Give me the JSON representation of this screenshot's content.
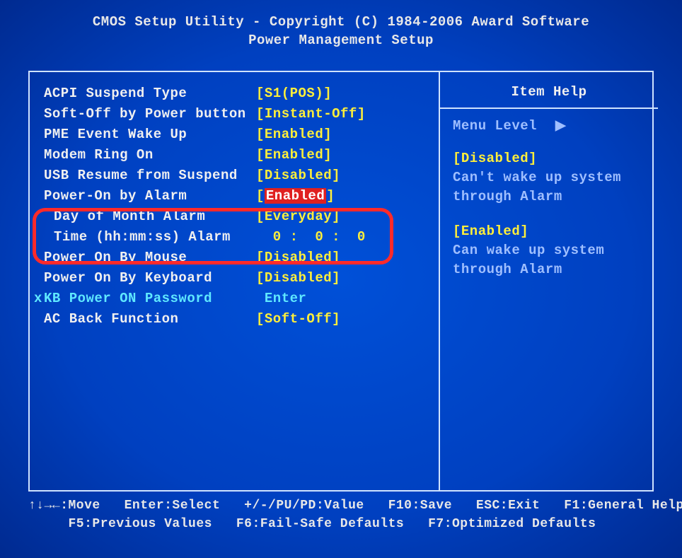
{
  "header": {
    "line1": "CMOS Setup Utility - Copyright (C) 1984-2006 Award Software",
    "line2": "Power Management Setup"
  },
  "settings": [
    {
      "label": "ACPI Suspend Type",
      "value": "[S1(POS)]",
      "indent": false,
      "disabled": false,
      "highlight": false
    },
    {
      "label": "Soft-Off by Power button",
      "value": "[Instant-Off]",
      "indent": false,
      "disabled": false,
      "highlight": false
    },
    {
      "label": "PME Event Wake Up",
      "value": "[Enabled]",
      "indent": false,
      "disabled": false,
      "highlight": false
    },
    {
      "label": "Modem Ring On",
      "value": "[Enabled]",
      "indent": false,
      "disabled": false,
      "highlight": false
    },
    {
      "label": "USB Resume from Suspend",
      "value": "[Disabled]",
      "indent": false,
      "disabled": false,
      "highlight": false
    },
    {
      "label": "Power-On by Alarm",
      "value": "Enabled",
      "indent": false,
      "disabled": false,
      "highlight": true
    },
    {
      "label": "Day of Month Alarm",
      "value": "[Everyday]",
      "indent": true,
      "disabled": false,
      "highlight": false
    },
    {
      "label": "Time (hh:mm:ss) Alarm",
      "value": "  0 :  0 :  0",
      "indent": true,
      "disabled": false,
      "highlight": false
    },
    {
      "label": "Power On By Mouse",
      "value": "[Disabled]",
      "indent": false,
      "disabled": false,
      "highlight": false
    },
    {
      "label": "Power On By Keyboard",
      "value": "[Disabled]",
      "indent": false,
      "disabled": false,
      "highlight": false
    },
    {
      "label": "KB Power ON Password",
      "value": " Enter",
      "indent": false,
      "disabled": true,
      "highlight": false,
      "prefix": "x"
    },
    {
      "label": "AC Back Function",
      "value": "[Soft-Off]",
      "indent": false,
      "disabled": false,
      "highlight": false
    }
  ],
  "help": {
    "title": "Item Help",
    "menu_level_label": "Menu Level",
    "menu_level_arrow": "▶",
    "disabled_head": "[Disabled]",
    "disabled_body1": "Can't wake up system",
    "disabled_body2": "through Alarm",
    "enabled_head": "[Enabled]",
    "enabled_body1": "Can wake up system",
    "enabled_body2": "through Alarm"
  },
  "footer": {
    "line1": "↑↓→←:Move   Enter:Select   +/-/PU/PD:Value   F10:Save   ESC:Exit   F1:General Help",
    "line2": "     F5:Previous Values   F6:Fail-Safe Defaults   F7:Optimized Defaults"
  }
}
